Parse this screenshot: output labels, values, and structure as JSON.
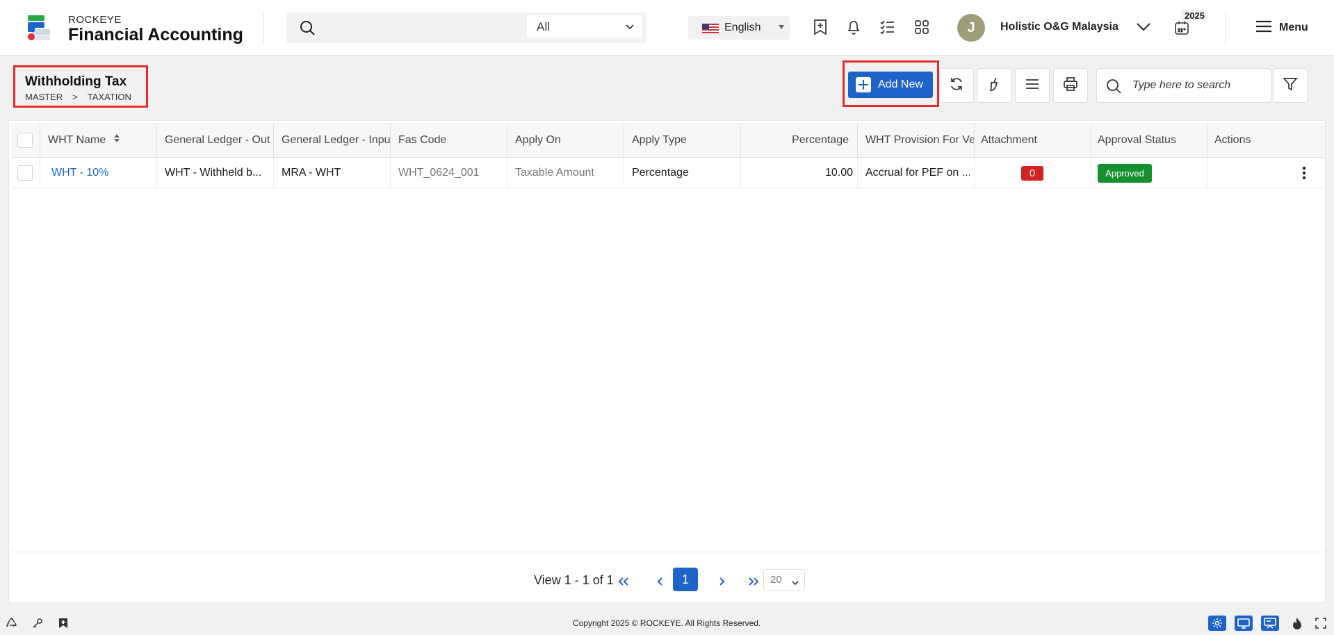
{
  "header": {
    "brand_top": "ROCKEYE",
    "brand_main": "Financial Accounting",
    "search_scope": "All",
    "language": "English",
    "company": "Holistic O&G Malaysia",
    "avatar_initial": "J",
    "year": "2025",
    "menu_label": "Menu"
  },
  "page": {
    "title": "Withholding Tax",
    "breadcrumb": [
      "MASTER",
      ">",
      "TAXATION"
    ],
    "add_button": "Add New",
    "search_placeholder": "Type here to search"
  },
  "table": {
    "columns": [
      "WHT Name",
      "General Ledger - Out",
      "General Ledger - Inpu",
      "Fas Code",
      "Apply On",
      "Apply Type",
      "Percentage",
      "WHT Provision For Ver",
      "Attachment",
      "Approval Status",
      "Actions"
    ],
    "rows": [
      {
        "wht_name": "WHT - 10%",
        "gl_out": "WHT - Withheld b...",
        "gl_in": "MRA - WHT",
        "fas_code": "WHT_0624_001",
        "apply_on": "Taxable Amount",
        "apply_type": "Percentage",
        "percentage": "10.00",
        "provision": "Accrual for PEF on ...",
        "attachment": "0",
        "approval": "Approved"
      }
    ]
  },
  "pager": {
    "view_text": "View 1 - 1 of 1",
    "page": "1",
    "page_size": "20"
  },
  "footer": {
    "copyright": "Copyright 2025 © ROCKEYE. All Rights Reserved."
  },
  "colors": {
    "primary": "#1e64c8",
    "highlight": "#e32d2d",
    "approved": "#16902f",
    "badge_red": "#d42121"
  }
}
